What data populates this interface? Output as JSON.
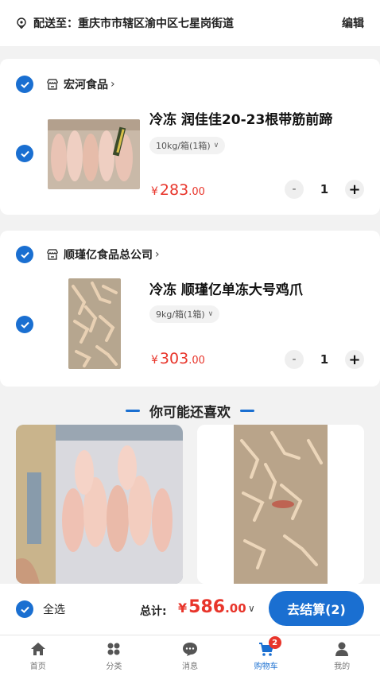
{
  "address": {
    "label": "配送至：重庆市市辖区渝中区七星岗街道",
    "edit_label": "编辑"
  },
  "stores": [
    {
      "name": "宏河食品",
      "arrow": "›",
      "item": {
        "title": "冷冻 润佳佳20-23根带筋前蹄",
        "spec": "10kg/箱(1箱)",
        "price_yen": "¥",
        "price_int": "283",
        "price_dec": ".00",
        "qty": "1"
      }
    },
    {
      "name": "顺瑾亿食品总公司",
      "arrow": "›",
      "item": {
        "title": "冷冻 顺瑾亿单冻大号鸡爪",
        "spec": "9kg/箱(1箱)",
        "price_yen": "¥",
        "price_int": "303",
        "price_dec": ".00",
        "qty": "1"
      }
    }
  ],
  "qty_controls": {
    "minus": "-",
    "plus": "+"
  },
  "recommend": {
    "title": "你可能还喜欢"
  },
  "footer": {
    "select_all": "全选",
    "total_label": "总计:",
    "total_yen": "¥",
    "total_int": "586",
    "total_dec": ".00",
    "checkout": "去结算(2)"
  },
  "tabs": [
    {
      "label": "首页",
      "icon": "home-icon"
    },
    {
      "label": "分类",
      "icon": "category-icon"
    },
    {
      "label": "消息",
      "icon": "message-icon"
    },
    {
      "label": "购物车",
      "icon": "cart-icon",
      "badge": "2",
      "active": true
    },
    {
      "label": "我的",
      "icon": "profile-icon"
    }
  ],
  "colors": {
    "accent": "#1a6fd1",
    "price": "#e8352b",
    "background": "#f2f2f2"
  }
}
